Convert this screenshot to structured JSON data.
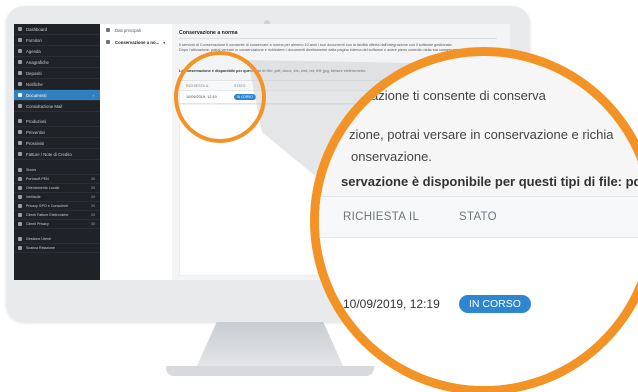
{
  "sidebar": {
    "items": [
      {
        "label": "Dashboard",
        "icon": "dashboard-icon"
      },
      {
        "label": "Fornitori",
        "icon": "truck-icon"
      },
      {
        "label": "Agenda",
        "icon": "calendar-icon"
      },
      {
        "label": "Anagrafiche",
        "icon": "address-book-icon"
      },
      {
        "label": "Depositi",
        "icon": "warehouse-icon"
      },
      {
        "label": "Notifiche",
        "icon": "bell-icon"
      },
      {
        "label": "Documenti",
        "icon": "document-icon",
        "active": true
      },
      {
        "label": "Consultazione Mail",
        "icon": "mail-icon"
      },
      {
        "label": "Produzioni",
        "icon": "factory-icon"
      },
      {
        "label": "Preventivi",
        "icon": "quote-icon"
      },
      {
        "label": "Prossivisi",
        "icon": "list-icon"
      },
      {
        "label": "Fatture / Note di Credito",
        "icon": "invoice-icon"
      }
    ],
    "small_items": [
      {
        "label": "Shoes",
        "count": ""
      },
      {
        "label": "Portosoft PEN",
        "count": "88"
      },
      {
        "label": "Orientamento Locale",
        "count": "88"
      },
      {
        "label": "Verifacile",
        "count": "88"
      },
      {
        "label": "Privacy GPO e Consulenti",
        "count": "88"
      },
      {
        "label": "Clienti Fatture Elettroniche",
        "count": "88"
      },
      {
        "label": "Clienti Privacy",
        "count": "88"
      }
    ],
    "bottom_items": [
      {
        "label": "Gestione Utenti"
      },
      {
        "label": "Scarica Relazione"
      }
    ]
  },
  "subnav": {
    "items": [
      {
        "label": "Dati principali",
        "active": false
      },
      {
        "label": "Conservazione a no...",
        "active": true
      }
    ]
  },
  "content": {
    "title": "Conservazione a norma",
    "intro": "Il servizio di Conservazione ti consente di conservare a norma per almeno 10 anni i tuoi documenti con la facilità offerta dall'integrazione con il software gestionale.",
    "text2": "Dopo l'attivazione, potrai versare in conservazione e richiedere i documenti direttamente dalla pagina interna del software e avere pieno controllo della tua conservazione.",
    "note": "La conservazione è disponibile per questi tipi di file: pdf, docx, xls, xml, txt, tiff, jpg, fatture elettroniche.",
    "table": {
      "headers": [
        "RICHIESTA IL",
        "STATO"
      ],
      "rows": [
        {
          "date": "10/09/2019, 12:19",
          "status": "IN CORSO"
        }
      ]
    }
  },
  "lens": {
    "line1": "azione ti consente di conserva",
    "line2": "zione, potrai versare in conservazione e richia",
    "line3": "onservazione.",
    "line4": "servazione è disponibile per questi tipi di file: pdf, docx,",
    "header1": "RICHIESTA IL",
    "header2": "STATO",
    "date": "10/09/2019, 12:19",
    "status": "IN CORSO"
  },
  "colors": {
    "accent": "#f39325",
    "badge": "#2e86d1",
    "sidebar_bg": "#1f2328",
    "sidebar_active": "#2f7fc1"
  }
}
